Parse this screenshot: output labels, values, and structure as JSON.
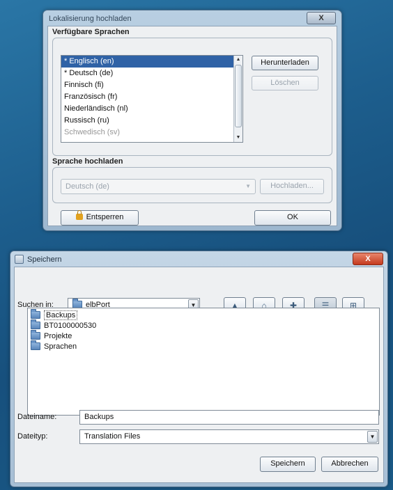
{
  "dialog1": {
    "title": "Lokalisierung hochladen",
    "close_label": "X",
    "available_group": "Verfügbare Sprachen",
    "languages": [
      "* Englisch (en)",
      "* Deutsch (de)",
      "Finnisch (fi)",
      "Französisch (fr)",
      "Niederländisch (nl)",
      "Russisch (ru)",
      "Schwedisch (sv)"
    ],
    "selected_index": 0,
    "download_label": "Herunterladen",
    "delete_label": "Löschen",
    "upload_group": "Sprache hochladen",
    "upload_language_value": "Deutsch (de)",
    "upload_label": "Hochladen...",
    "unlock_label": "Entsperren",
    "ok_label": "OK"
  },
  "dialog2": {
    "title": "Speichern",
    "close_label": "X",
    "look_in_label": "Suchen in:",
    "look_in_value": "elbPort",
    "files": [
      "Backups",
      "BT0100000530",
      "Projekte",
      "Sprachen"
    ],
    "filename_label": "Dateiname:",
    "filename_value": "Backups",
    "filetype_label": "Dateityp:",
    "filetype_value": "Translation Files",
    "save_label": "Speichern",
    "cancel_label": "Abbrechen"
  },
  "colors": {
    "desktop": "#1f5f8f",
    "selection": "#2f62a6",
    "close_red": "#c43a1e"
  }
}
